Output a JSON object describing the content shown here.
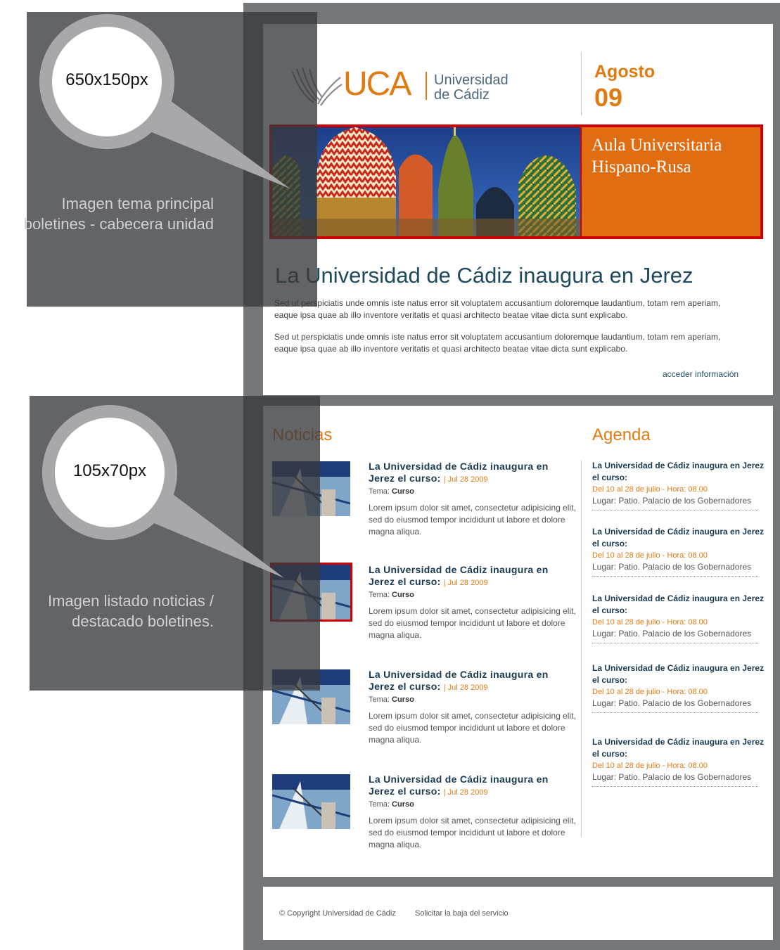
{
  "header": {
    "logo_word": "UCA",
    "logo_text_1": "Universidad",
    "logo_text_2": "de Cádiz",
    "date_month": "Agosto",
    "date_day": "09"
  },
  "banner": {
    "title": "Aula Universitaria Hispano-Rusa",
    "image_icon": "kremlin-domes-image"
  },
  "main": {
    "title": "La Universidad de Cádiz inaugura en Jerez",
    "paragraphs": [
      "Sed ut perspiciatis unde omnis iste natus error sit voluptatem accusantium doloremque laudantium, totam rem aperiam, eaque ipsa quae ab illo inventore veritatis et quasi architecto beatae vitae dicta sunt explicabo.",
      "Sed ut perspiciatis unde omnis iste natus error sit voluptatem accusantium doloremque laudantium, totam rem aperiam, eaque ipsa quae ab illo inventore veritatis et quasi architecto beatae vitae dicta sunt explicabo."
    ],
    "more_link": "acceder información"
  },
  "noticias": {
    "title": "Noticias",
    "items": [
      {
        "title": "La Universidad de Cádiz inaugura en Jerez el curso:",
        "date": "| Jul 28 2009",
        "tema_label": "Tema:",
        "tema": "Curso",
        "body": "Lorem ipsum dolor sit amet, consectetur adipisicing elit, sed do eiusmod tempor incididunt ut labore et dolore magna aliqua."
      },
      {
        "title": "La Universidad de Cádiz inaugura en Jerez el curso:",
        "date": "| Jul 28 2009",
        "tema_label": "Tema:",
        "tema": "Curso",
        "body": "Lorem ipsum dolor sit amet, consectetur adipisicing elit, sed do eiusmod tempor incididunt ut labore et dolore magna aliqua."
      },
      {
        "title": "La Universidad de Cádiz inaugura en Jerez el curso:",
        "date": "| Jul 28 2009",
        "tema_label": "Tema:",
        "tema": "Curso",
        "body": "Lorem ipsum dolor sit amet, consectetur adipisicing elit, sed do eiusmod tempor incididunt ut labore et dolore magna aliqua."
      },
      {
        "title": "La Universidad de Cádiz inaugura en Jerez el curso:",
        "date": "| Jul 28 2009",
        "tema_label": "Tema:",
        "tema": "Curso",
        "body": "Lorem ipsum dolor sit amet, consectetur adipisicing elit, sed do eiusmod tempor incididunt ut labore et dolore magna aliqua."
      }
    ]
  },
  "agenda": {
    "title": "Agenda",
    "items": [
      {
        "title": "La Universidad de Cádiz inaugura en Jerez el curso:",
        "when": "Del 10 al 28 de julio  - Hora:  08.00",
        "place": "Lugar: Patio. Palacio de los Gobernadores"
      },
      {
        "title": "La Universidad de Cádiz inaugura en Jerez el curso:",
        "when": "Del 10 al 28 de julio  - Hora:  08.00",
        "place": "Lugar: Patio. Palacio de los Gobernadores"
      },
      {
        "title": "La Universidad de Cádiz inaugura en Jerez el curso:",
        "when": "Del 10 al 28 de julio  - Hora:  08.00",
        "place": "Lugar: Patio. Palacio de los Gobernadores"
      },
      {
        "title": "La Universidad de Cádiz inaugura en Jerez el curso:",
        "when": "Del 10 al 28 de julio  - Hora:  08.00",
        "place": "Lugar: Patio. Palacio de los Gobernadores"
      },
      {
        "title": "La Universidad de Cádiz inaugura en Jerez el curso:",
        "when": "Del 10 al 28 de julio  - Hora:  08.00",
        "place": "Lugar: Patio. Palacio de los Gobernadores"
      }
    ]
  },
  "footer": {
    "copyright": "© Copyright Universidad de Cádiz",
    "unsubscribe": "Solicitar la baja del servicio"
  },
  "annotations": {
    "header_size": "650x150px",
    "header_label": "Imagen tema principal boletines - cabecera unidad",
    "list_size": "105x70px",
    "list_label": "Imagen listado noticias / destacado boletines."
  },
  "colors": {
    "accent": "#e07b12",
    "brand_blue": "#25577e",
    "highlight_border": "#cc0000",
    "frame": "#75767a"
  }
}
